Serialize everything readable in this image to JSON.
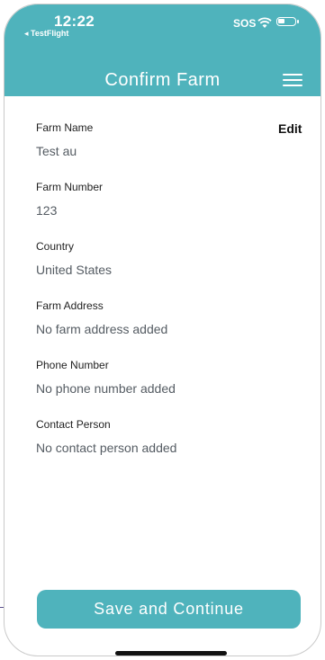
{
  "status_bar": {
    "time": "12:22",
    "back_app": "◂ TestFlight",
    "sos": "SOS"
  },
  "header": {
    "title": "Confirm Farm",
    "menu_icon": "hamburger-menu-icon"
  },
  "actions": {
    "edit_label": "Edit"
  },
  "fields": [
    {
      "label": "Farm Name",
      "value": "Test au"
    },
    {
      "label": "Farm Number",
      "value": "123"
    },
    {
      "label": "Country",
      "value": "United States"
    },
    {
      "label": "Farm Address",
      "value": "No farm address added"
    },
    {
      "label": "Phone Number",
      "value": "No phone number added"
    },
    {
      "label": "Contact Person",
      "value": "No contact person added"
    }
  ],
  "footer": {
    "save_label": "Save and Continue"
  },
  "colors": {
    "accent": "#4fb3bc",
    "label_text": "#1f1f1f",
    "value_text": "#555c63"
  }
}
